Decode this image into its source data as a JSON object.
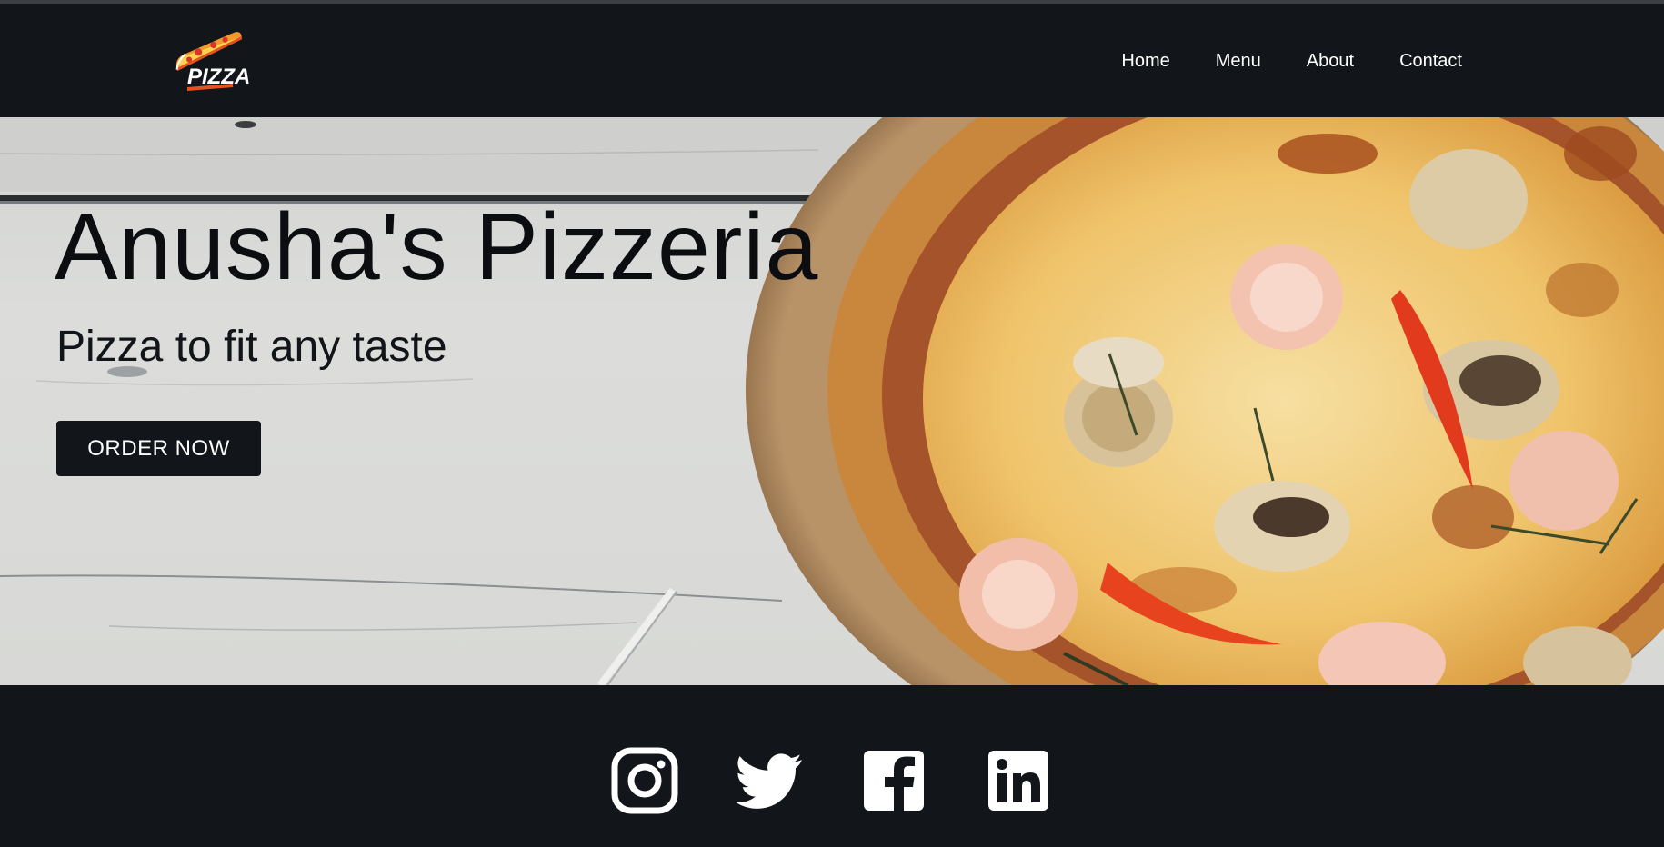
{
  "brand": {
    "logo_text": "PIZZA"
  },
  "nav": {
    "home": "Home",
    "menu": "Menu",
    "about": "About",
    "contact": "Contact"
  },
  "hero": {
    "title": "Anusha's Pizzeria",
    "subtitle": "Pizza to fit any taste",
    "cta": "ORDER NOW"
  },
  "social": [
    "instagram-icon",
    "twitter-icon",
    "facebook-icon",
    "linkedin-icon"
  ],
  "colors": {
    "dark": "#12161a",
    "wood": "#dfe0dd",
    "crust": "#c9873d",
    "cheese": "#efc36a",
    "chili": "#e23a1d"
  }
}
